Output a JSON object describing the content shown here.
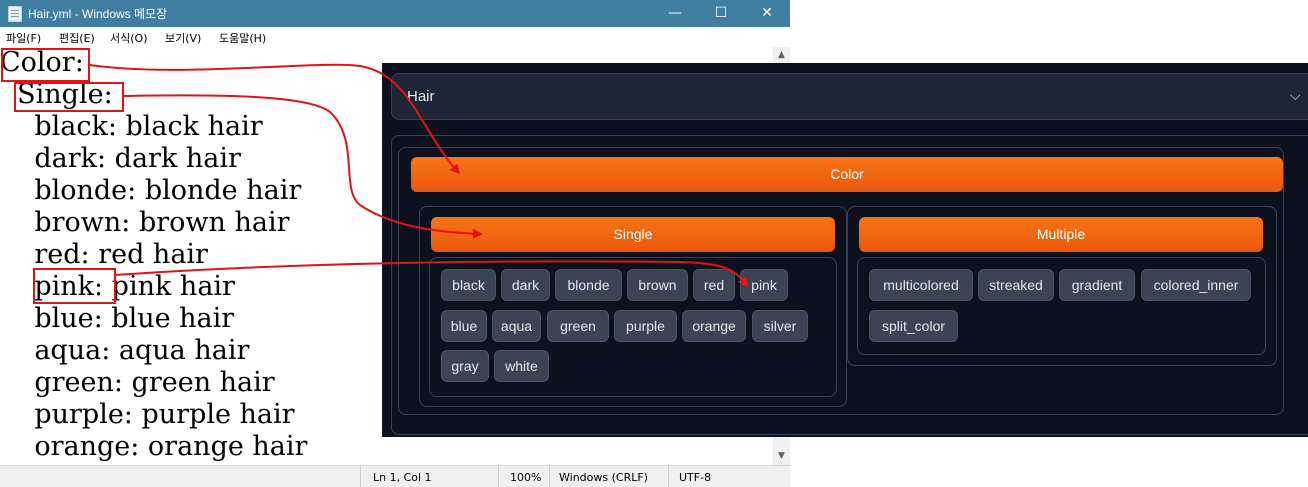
{
  "notepad": {
    "title": "Hair.yml - Windows 메모장",
    "controls": {
      "minimize": "—",
      "maximize": "☐",
      "close": "✕"
    },
    "menu": [
      "파일(F)",
      "편집(E)",
      "서식(O)",
      "보기(V)",
      "도움말(H)"
    ],
    "lines": [
      "Color:",
      "  Single:",
      "    black: black hair",
      "    dark: dark hair",
      "    blonde: blonde hair",
      "    brown: brown hair",
      "    red: red hair",
      "    pink: pink hair",
      "    blue: blue hair",
      "    aqua: aqua hair",
      "    green: green hair",
      "    purple: purple hair",
      "    orange: orange hair"
    ],
    "status": {
      "position": "Ln 1, Col 1",
      "zoom": "100%",
      "line_ending": "Windows (CRLF)",
      "encoding": "UTF-8"
    }
  },
  "panel": {
    "accordion_title": "Hair",
    "color_label": "Color",
    "single_label": "Single",
    "multiple_label": "Multiple",
    "single_tags": [
      "black",
      "dark",
      "blonde",
      "brown",
      "red",
      "pink",
      "blue",
      "aqua",
      "green",
      "purple",
      "orange",
      "silver",
      "gray",
      "white"
    ],
    "multiple_tags": [
      "multicolored",
      "streaked",
      "gradient",
      "colored_inner",
      "split_color"
    ]
  },
  "colors": {
    "accent_orange": "#f97316",
    "highlight_red": "#e01414",
    "panel_bg": "#0c111d",
    "titlebar": "#3f7ea1"
  }
}
